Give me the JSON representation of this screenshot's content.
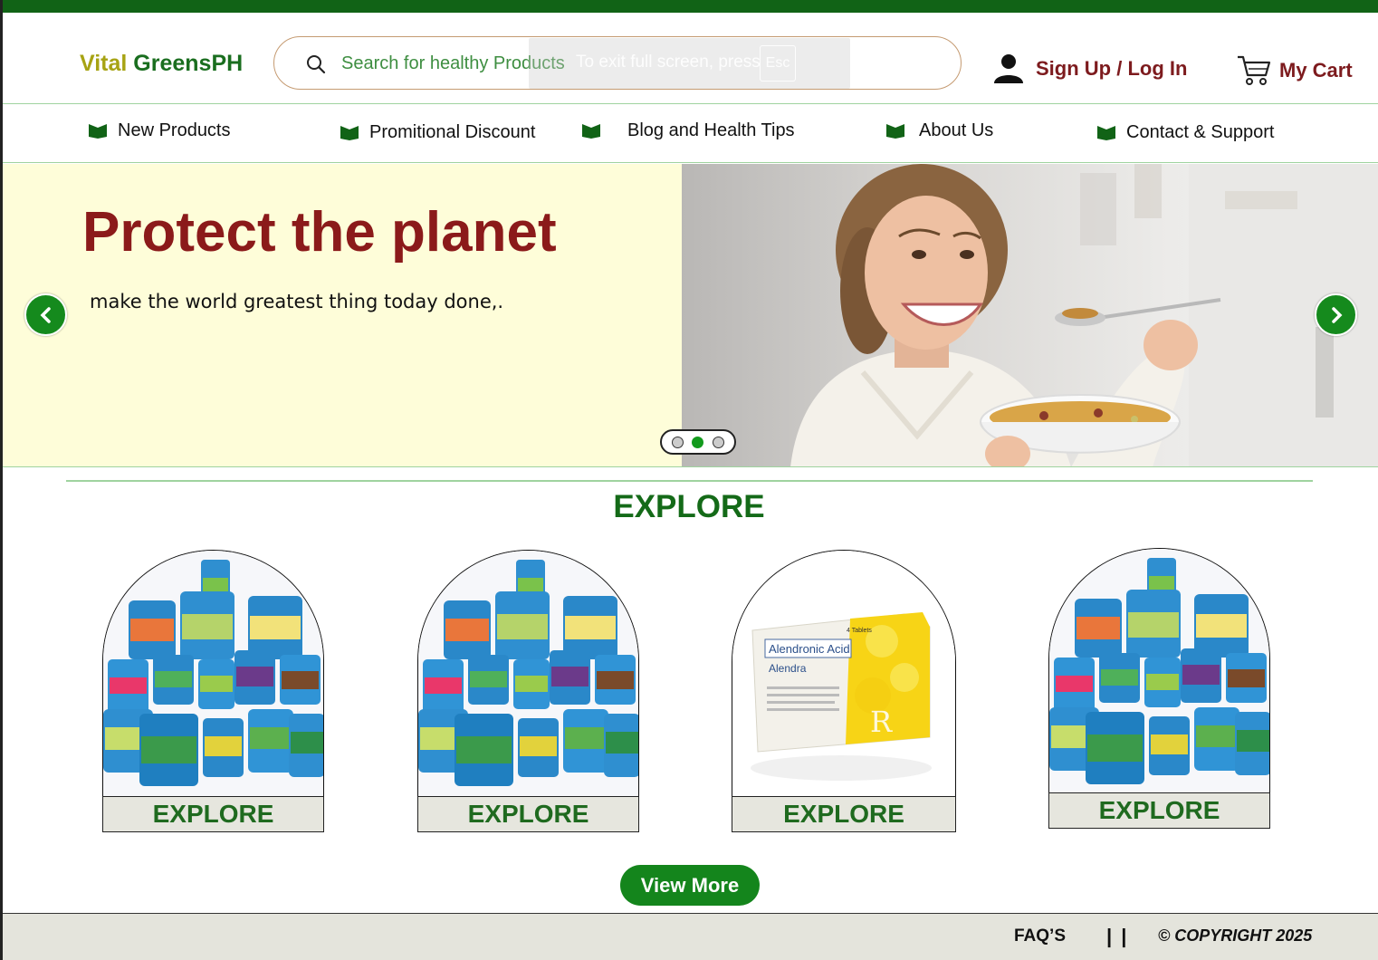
{
  "header": {
    "logo_part1": "Vital",
    "logo_part2": "GreensPH",
    "search_placeholder": "Search for healthy Products",
    "signin_label": "Sign Up / Log In",
    "cart_label": "My Cart"
  },
  "fullscreen_notice": {
    "text": "To exit full screen, press",
    "key": "Esc"
  },
  "nav": {
    "items": [
      {
        "label": "New Products"
      },
      {
        "label": "Promitional Discount"
      },
      {
        "label": "Blog and Health Tips"
      },
      {
        "label": "About Us"
      },
      {
        "label": "Contact & Support"
      }
    ]
  },
  "hero": {
    "title": "Protect the planet",
    "subtitle": "make the world greatest thing today done,.",
    "active_slide": 2,
    "slide_count": 3
  },
  "explore": {
    "title": "EXPLORE",
    "cards": [
      {
        "label": "EXPLORE",
        "image": "supplement-jars"
      },
      {
        "label": "EXPLORE",
        "image": "supplement-jars"
      },
      {
        "label": "EXPLORE",
        "image": "medicine-box"
      },
      {
        "label": "EXPLORE",
        "image": "supplement-jars"
      }
    ],
    "view_more": "View More"
  },
  "medicine_box": {
    "name": "Alendronic Acid",
    "brand": "Alendra",
    "count": "4 Tablets"
  },
  "footer": {
    "faq": "FAQ’S",
    "separator": "| |",
    "copyright": "© COPYRIGHT 2025"
  },
  "colors": {
    "brand_green": "#116316",
    "button_green": "#14851c",
    "maroon": "#7d1b1e",
    "hero_bg": "#fefdd9"
  }
}
